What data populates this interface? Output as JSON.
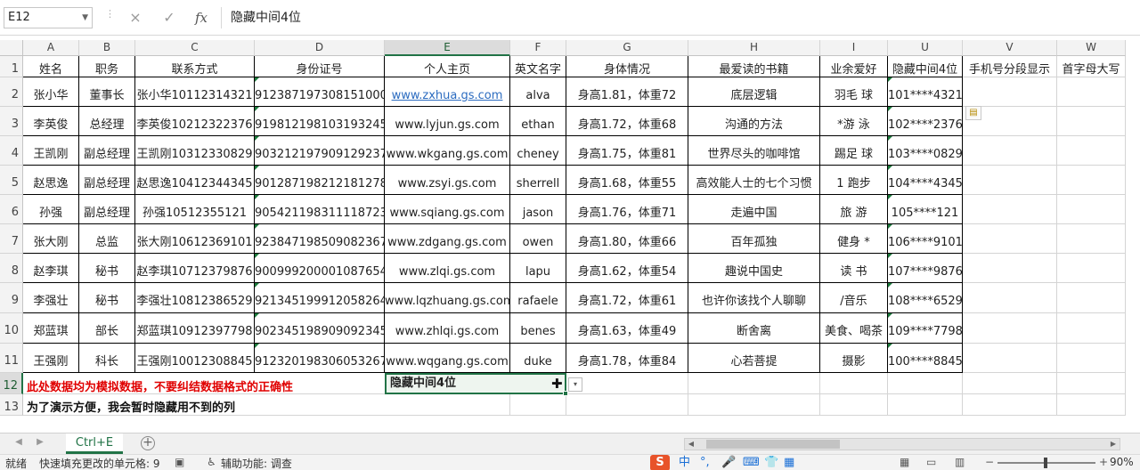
{
  "formula_bar": {
    "name_box": "E12",
    "cancel_icon": "×",
    "enter_icon": "✓",
    "fx_label": "fx",
    "content": "隐藏中间4位"
  },
  "columns": [
    "A",
    "B",
    "C",
    "D",
    "E",
    "F",
    "G",
    "H",
    "I",
    "U",
    "V",
    "W"
  ],
  "row_numbers": [
    "1",
    "2",
    "3",
    "4",
    "5",
    "6",
    "7",
    "8",
    "9",
    "10",
    "11",
    "12",
    "13"
  ],
  "headers": [
    "姓名",
    "职务",
    "联系方式",
    "身份证号",
    "个人主页",
    "英文名字",
    "身体情况",
    "最爱读的书籍",
    "业余爱好",
    "隐藏中间4位",
    "手机号分段显示",
    "首字母大写"
  ],
  "rows": [
    [
      "张小华",
      "董事长",
      "张小华10112314321",
      "912387197308151000",
      "www.zxhua.gs.com",
      "alva",
      "身高1.81，体重72",
      "底层逻辑",
      "羽毛  球",
      "101****4321",
      "",
      ""
    ],
    [
      "李英俊",
      "总经理",
      "李英俊10212322376",
      "919812198103193245",
      "www.lyjun.gs.com",
      "ethan",
      "身高1.72，体重68",
      "沟通的方法",
      "*游  泳",
      "102****2376",
      "",
      ""
    ],
    [
      "王凯刚",
      "副总经理",
      "王凯刚10312330829",
      "903212197909129237",
      "www.wkgang.gs.com",
      "cheney",
      "身高1.75，体重81",
      "世界尽头的咖啡馆",
      "踢足  球",
      "103****0829",
      "",
      ""
    ],
    [
      "赵思逸",
      "副总经理",
      "赵思逸10412344345",
      "901287198212181278",
      "www.zsyi.gs.com",
      "sherrell",
      "身高1.68，体重55",
      "高效能人士的七个习惯",
      "1 跑步",
      "104****4345",
      "",
      ""
    ],
    [
      "孙强",
      "副总经理",
      "孙强10512355121",
      "905421198311118723",
      "www.sqiang.gs.com",
      "jason",
      "身高1.76，体重71",
      "走遍中国",
      "旅    游",
      "105****121",
      "",
      ""
    ],
    [
      "张大刚",
      "总监",
      "张大刚10612369101",
      "923847198509082367",
      "www.zdgang.gs.com",
      "owen",
      "身高1.80，体重66",
      "百年孤独",
      "健身 *",
      "106****9101",
      "",
      ""
    ],
    [
      "赵李琪",
      "秘书",
      "赵李琪10712379876",
      "900999200001087654",
      "www.zlqi.gs.com",
      "lapu",
      "身高1.62，体重54",
      "趣说中国史",
      "读  书",
      "107****9876",
      "",
      ""
    ],
    [
      "李强壮",
      "秘书",
      "李强壮10812386529",
      "921345199912058264",
      "www.lqzhuang.gs.com",
      "rafaele",
      "身高1.72，体重61",
      "也许你该找个人聊聊",
      "/音乐",
      "108****6529",
      "",
      ""
    ],
    [
      "郑蓝琪",
      "部长",
      "郑蓝琪10912397798",
      "902345198909092345",
      "www.zhlqi.gs.com",
      "benes",
      "身高1.63，体重49",
      "断舍离",
      "美食、喝茶",
      "109****7798",
      "",
      ""
    ],
    [
      "王强刚",
      "科长",
      "王强刚10012308845",
      "912320198306053267",
      "www.wqgang.gs.com",
      "duke",
      "身高1.78，体重84",
      "心若菩提",
      "摄影",
      "100****8845",
      "",
      ""
    ]
  ],
  "note_red": "此处数据均为模拟数据，不要纠结数据格式的正确性",
  "note_black": "为了演示方便，我会暂时隐藏用不到的列",
  "active_cell_value": "隐藏中间4位",
  "sheet_tab": "Ctrl+E",
  "status": {
    "ready": "就绪",
    "flash_fill": "快速填充更改的单元格: 9",
    "accessibility": "辅助功能: 调查",
    "zoom": "90%",
    "ime_logo": "S",
    "ime_lang": "中"
  },
  "colors": {
    "accent": "#217346",
    "note_red": "#e00000",
    "link": "#2c6cc0"
  }
}
